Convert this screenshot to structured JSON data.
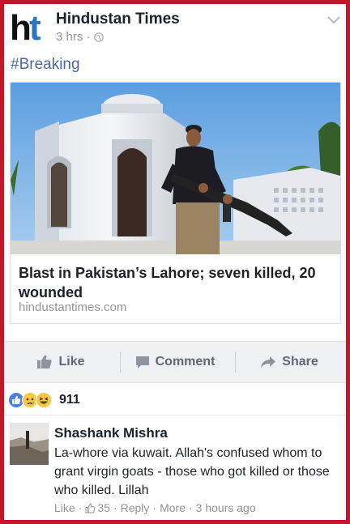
{
  "post": {
    "page_name": "Hindustan Times",
    "logo_text": "ht",
    "time": "3 hrs",
    "meta_sep": "·",
    "hashtag": "#Breaking",
    "link": {
      "headline": "Blast in Pakistan’s Lahore; seven killed, 20 wounded",
      "domain": "hindustantimes.com"
    }
  },
  "actions": {
    "like": "Like",
    "comment": "Comment",
    "share": "Share"
  },
  "reactions": {
    "icons": [
      "like-reaction-icon",
      "sad-reaction-icon",
      "haha-reaction-icon"
    ],
    "count": "911"
  },
  "comment": {
    "author": "Shashank Mishra",
    "text": "La-whore via kuwait. Allah's confused whom to grant virgin goats - those who got killed or those who killed. Lillah",
    "like_label": "Like",
    "like_count": "35",
    "reply_label": "Reply",
    "more_label": "More",
    "time": "3 hours ago",
    "sep": "·"
  },
  "colors": {
    "frame": "#c0172a",
    "link_blue": "#4b67a1",
    "text": "#1d2129",
    "muted": "#90949c",
    "action_bar": "#eff0f3"
  }
}
